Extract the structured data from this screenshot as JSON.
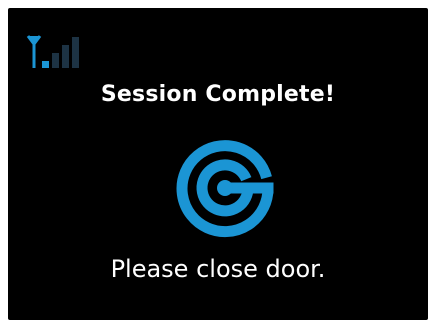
{
  "screen": {
    "title": "Session Complete!",
    "message": "Please close door.",
    "signal_icon": "signal-strength-icon",
    "signal_bars_active": 1,
    "signal_bars_total": 4,
    "logo_icon": "brand-logo-icon"
  },
  "colors": {
    "background": "#000000",
    "text": "#ffffff",
    "accent": "#1b95d4",
    "inactive": "#1d3344"
  }
}
